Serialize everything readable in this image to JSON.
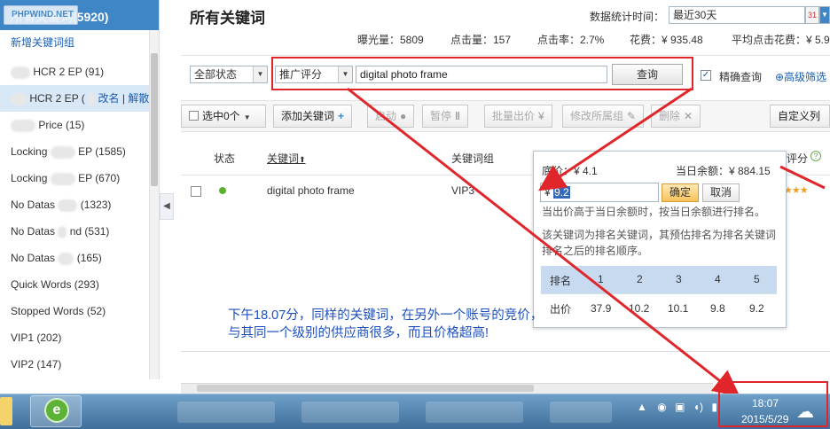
{
  "sidebar": {
    "header_title": "所有关键词(5920)",
    "logo_text": "PHPWIND.NET",
    "add_group": "新增关键词组",
    "items": [
      {
        "label": "HCR 2 EP (91)"
      },
      {
        "label": "HCR 2 EP (",
        "edit": "改名",
        "sep": "|",
        "dissolve": "解散"
      },
      {
        "label": "Price (15)"
      },
      {
        "pre": "Locking",
        "label": "EP (1585)"
      },
      {
        "pre": "Locking",
        "label": "EP (670)"
      },
      {
        "pre": "No Datas",
        "label": "(1323)"
      },
      {
        "pre": "No Datas",
        "label": "nd (531)"
      },
      {
        "pre": "No Datas",
        "label": "(165)"
      },
      {
        "label": "Quick Words (293)"
      },
      {
        "label": "Stopped Words (52)"
      },
      {
        "label": "VIP1 (202)"
      },
      {
        "label": "VIP2 (147)"
      }
    ]
  },
  "header": {
    "title": "所有关键词",
    "range_label": "数据统计时间：",
    "range_value": "最近30天",
    "calendar_icon": "calendar-icon",
    "stats": {
      "impressions": "曝光量：5809",
      "clicks": "点击量：157",
      "ctr": "点击率：2.7%",
      "spend": "花费：¥ 935.48",
      "avg_cpc": "平均点击花费：¥ 5.9"
    }
  },
  "filter": {
    "status_value": "全部状态",
    "rating_value": "推广评分",
    "keyword_value": "digital photo frame",
    "query_label": "查询",
    "precise_label": "精确查询",
    "precise_checked": "✓",
    "advanced_label": "⊕高级筛选"
  },
  "toolbar": {
    "select_label": "选中0个",
    "add_keyword": "添加关键词",
    "start": "启动",
    "pause": "暂停",
    "batch_bid": "批量出价",
    "move_group": "修改所属组",
    "delete": "删除",
    "customize": "自定义列"
  },
  "table": {
    "headers": {
      "status": "状态",
      "keyword": "关键词",
      "keyword_sort": "⬆",
      "group": "关键词组",
      "score": "评分"
    },
    "row": {
      "keyword": "digital photo frame",
      "group": "VIP3",
      "stars": "★★★"
    }
  },
  "popup": {
    "floor_price": "底价：¥ 4.1",
    "daily_balance": "当日余额：¥ 884.15",
    "currency": "¥",
    "bid_value": "9.2",
    "ok_label": "确定",
    "cancel_label": "取消",
    "note1": "当出价高于当日余额时，按当日余额进行排名。",
    "note2": "该关键词为排名关键词，其预估排名为排名关键词",
    "note3": "排名之后的排名顺序。",
    "rank_header": "排名",
    "price_header": "出价",
    "ranks": [
      "1",
      "2",
      "3",
      "4",
      "5"
    ],
    "prices": [
      "37.9",
      "10.2",
      "10.1",
      "9.8",
      "9.2"
    ]
  },
  "annotation": {
    "line1": "下午18.07分，同样的关键词，在另外一个账号的竞价，",
    "line2": "与其同一个级别的供应商很多，而且价格超高!"
  },
  "taskbar": {
    "time": "18:07",
    "date": "2015/5/29",
    "tray_icons": [
      "chevron-up-icon",
      "qq-icon",
      "security-icon",
      "volume-icon",
      "network-icon"
    ],
    "ie_glyph": "e",
    "tray_text": "▲"
  },
  "colors": {
    "accent": "#3f86c7",
    "highlight_red": "#e0262a",
    "annotation_blue": "#1d4fbf",
    "status_green": "#5bb12f"
  }
}
